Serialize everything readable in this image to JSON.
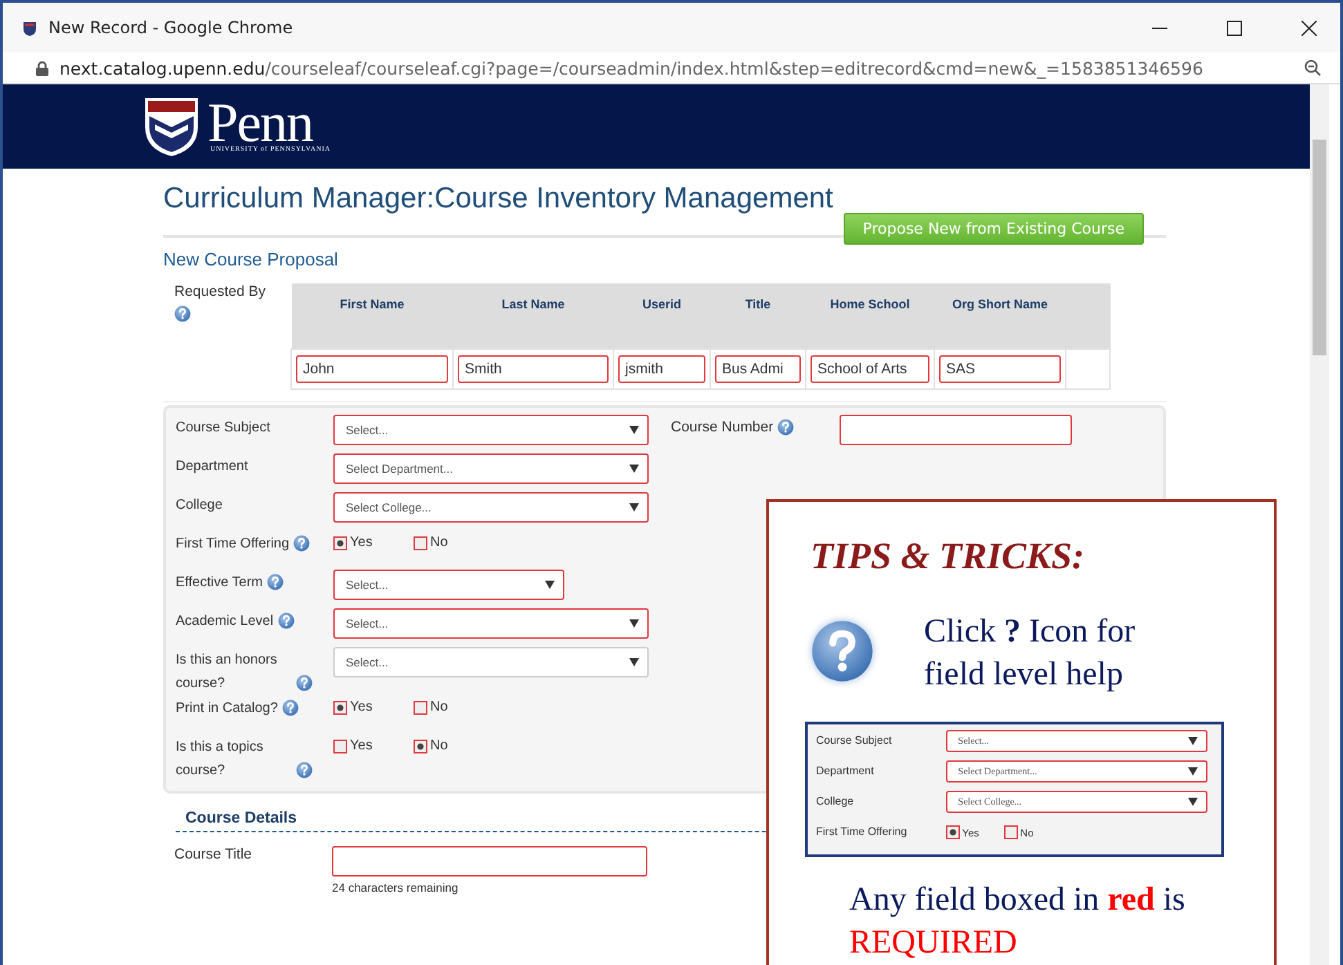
{
  "window": {
    "title": "New Record - Google Chrome",
    "url_host": "next.catalog.upenn.edu",
    "url_path": "/courseleaf/courseleaf.cgi?page=/courseadmin/index.html&step=editrecord&cmd=new&_=1583851346596"
  },
  "banner": {
    "logo_text": "Penn",
    "logo_subtitle": "UNIVERSITY of PENNSYLVANIA"
  },
  "page": {
    "heading": "Curriculum Manager:Course Inventory Management",
    "action_button": "Propose New from Existing Course",
    "subheading": "New Course Proposal"
  },
  "requested_by": {
    "label": "Requested By",
    "columns": [
      "First Name",
      "Last Name",
      "Userid",
      "Title",
      "Home School",
      "Org Short Name"
    ],
    "values": [
      "John",
      "Smith",
      "jsmith",
      "Bus Admi",
      "School of Arts",
      "SAS"
    ]
  },
  "form": {
    "course_number": {
      "label": "Course Number",
      "required": true
    },
    "fields": [
      {
        "label": "Course Subject",
        "kind": "select",
        "placeholder": "Select...",
        "required": true,
        "help": false
      },
      {
        "label": "Department",
        "kind": "select",
        "placeholder": "Select Department...",
        "required": true,
        "help": false
      },
      {
        "label": "College",
        "kind": "select",
        "placeholder": "Select College...",
        "required": true,
        "help": false
      },
      {
        "label": "First Time Offering",
        "kind": "radio",
        "help": true,
        "options": [
          {
            "label": "Yes",
            "selected": true,
            "required": true
          },
          {
            "label": "No",
            "selected": false,
            "required": true
          }
        ]
      },
      {
        "label": "Effective Term",
        "kind": "select",
        "placeholder": "Select...",
        "required": true,
        "help": true,
        "short": true
      },
      {
        "label": "Academic Level",
        "kind": "select",
        "placeholder": "Select...",
        "required": true,
        "help": true
      },
      {
        "label": "Is this an honors course?",
        "kind": "select",
        "placeholder": "Select...",
        "required": false,
        "help": true
      },
      {
        "label": "Print in Catalog?",
        "kind": "radio",
        "help": true,
        "options": [
          {
            "label": "Yes",
            "selected": true,
            "required": true
          },
          {
            "label": "No",
            "selected": false,
            "required": true
          }
        ]
      },
      {
        "label": "Is this a topics course?",
        "kind": "radio",
        "help": true,
        "options": [
          {
            "label": "Yes",
            "selected": false,
            "required": true
          },
          {
            "label": "No",
            "selected": true,
            "required": true
          }
        ]
      }
    ]
  },
  "course_details": {
    "heading": "Course Details",
    "title_label": "Course Title",
    "title_required": true,
    "remaining": "24 characters remaining"
  },
  "tips": {
    "title": "TIPS & TRICKS:",
    "help_text": "Click **?** Icon for field level help",
    "example": [
      {
        "label": "Course Subject",
        "kind": "select",
        "placeholder": "Select...",
        "required": true
      },
      {
        "label": "Department",
        "kind": "select",
        "placeholder": "Select Department...",
        "required": true
      },
      {
        "label": "College",
        "kind": "select",
        "placeholder": "Select College...",
        "required": true
      },
      {
        "label": "First Time Offering",
        "kind": "radio",
        "options": [
          {
            "label": "Yes",
            "selected": true,
            "required": true
          },
          {
            "label": "No",
            "selected": false,
            "required": true
          }
        ]
      }
    ],
    "note": [
      {
        "text": "Any field boxed in",
        "kind": "plain"
      },
      {
        "text": "red",
        "kind": "highlight"
      },
      {
        "text": "is",
        "kind": "plain"
      },
      {
        "text": "REQUIRED",
        "kind": "alert"
      }
    ]
  }
}
